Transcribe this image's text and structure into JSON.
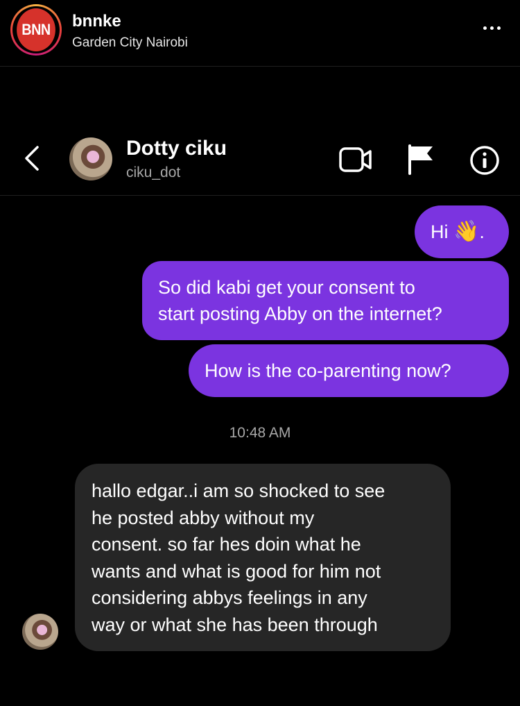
{
  "post": {
    "logo_text": "BNN",
    "username": "bnnke",
    "location": "Garden City Nairobi"
  },
  "dm": {
    "contact_name": "Dotty ciku",
    "contact_handle": "ciku_dot"
  },
  "messages": {
    "sent": [
      {
        "text": "Hi ",
        "suffix": ".",
        "emoji": "👋"
      },
      {
        "lines": [
          "So did kabi get your consent to",
          "start posting Abby on the internet?"
        ]
      },
      {
        "text": "How is the co-parenting now?"
      }
    ],
    "timestamp": "10:48 AM",
    "received": {
      "lines": [
        "hallo edgar..i am so shocked to see",
        "he posted abby without my",
        "consent. so far hes doin what he",
        "wants and what is good for him not",
        "considering abbys feelings in any",
        "way or what she has been through"
      ]
    }
  },
  "colors": {
    "background": "#000000",
    "sent_bubble": "#7b34e0",
    "received_bubble": "#262626",
    "secondary_text": "#a8a8a8"
  },
  "icons": [
    "more-icon",
    "back-icon",
    "video-call-icon",
    "flag-icon",
    "info-icon"
  ]
}
